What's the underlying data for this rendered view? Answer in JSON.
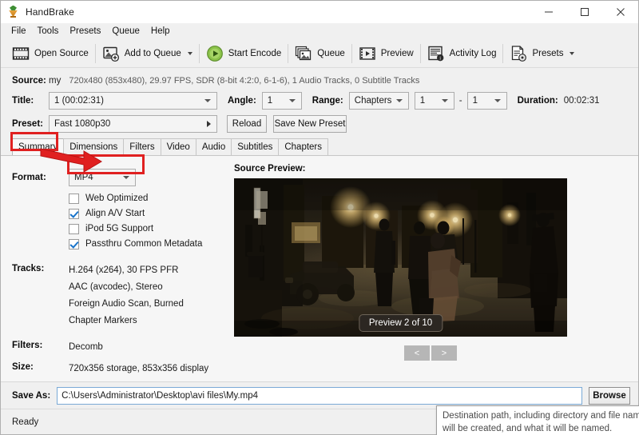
{
  "window": {
    "title": "HandBrake",
    "logo_icon": "handbrake-logo",
    "minimize_label": "—",
    "maximize_label": "□",
    "close_label": "✕"
  },
  "menubar": {
    "items": [
      {
        "label": "File"
      },
      {
        "label": "Tools"
      },
      {
        "label": "Presets"
      },
      {
        "label": "Queue"
      },
      {
        "label": "Help"
      }
    ]
  },
  "toolbar": {
    "items": [
      {
        "label": "Open Source",
        "icon": "film-strip-icon",
        "has_caret": false
      },
      {
        "label": "Add to Queue",
        "icon": "add-image-icon",
        "has_caret": true
      },
      {
        "label": "Start Encode",
        "icon": "green-play-icon",
        "has_caret": false
      },
      {
        "label": "Queue",
        "icon": "stacked-images-icon",
        "has_caret": false
      },
      {
        "label": "Preview",
        "icon": "film-play-icon",
        "has_caret": false
      },
      {
        "label": "Activity Log",
        "icon": "log-info-icon",
        "has_caret": false
      },
      {
        "label": "Presets",
        "icon": "document-gear-icon",
        "has_caret": true
      }
    ]
  },
  "source": {
    "label": "Source:",
    "name": "my",
    "details": "720x480 (853x480), 29.97 FPS, SDR (8-bit 4:2:0, 6-1-6), 1 Audio Tracks, 0 Subtitle Tracks"
  },
  "title_row": {
    "title_label": "Title:",
    "title_value": "1  (00:02:31)",
    "angle_label": "Angle:",
    "angle_value": "1",
    "range_label": "Range:",
    "range_value": "Chapters",
    "chapter_start": "1",
    "chapter_sep": "-",
    "chapter_end": "1",
    "duration_label": "Duration:",
    "duration_value": "00:02:31"
  },
  "preset_row": {
    "preset_label": "Preset:",
    "preset_value": "Fast 1080p30",
    "reload_label": "Reload",
    "save_new_preset_label": "Save New Preset"
  },
  "tabs": [
    {
      "label": "Summary",
      "active": true
    },
    {
      "label": "Dimensions",
      "active": false
    },
    {
      "label": "Filters",
      "active": false
    },
    {
      "label": "Video",
      "active": false
    },
    {
      "label": "Audio",
      "active": false
    },
    {
      "label": "Subtitles",
      "active": false
    },
    {
      "label": "Chapters",
      "active": false
    }
  ],
  "summary": {
    "format_label": "Format:",
    "format_value": "MP4",
    "checkboxes": [
      {
        "label": "Web Optimized",
        "checked": false
      },
      {
        "label": "Align A/V Start",
        "checked": true
      },
      {
        "label": "iPod 5G Support",
        "checked": false
      },
      {
        "label": "Passthru Common Metadata",
        "checked": true
      }
    ],
    "tracks_label": "Tracks:",
    "tracks": [
      "H.264 (x264), 30 FPS PFR",
      "AAC (avcodec), Stereo",
      "Foreign Audio Scan, Burned",
      "Chapter Markers"
    ],
    "filters_label": "Filters:",
    "filters_value": "Decomb",
    "size_label": "Size:",
    "size_value": "720x356 storage, 853x356 display"
  },
  "preview": {
    "label": "Source Preview:",
    "badge": "Preview 2 of 10",
    "prev_label": "<",
    "next_label": ">"
  },
  "save_as": {
    "label": "Save As:",
    "value": "C:\\Users\\Administrator\\Desktop\\avi files\\My.mp4",
    "browse_label": "Browse"
  },
  "status": {
    "text": "Ready"
  },
  "tooltip": {
    "line1": "Destination path, including directory and file name. Th",
    "line2": "will be created, and what it will be named."
  },
  "annotations": {
    "highlight_color": "#e02020",
    "boxes": [
      {
        "target": "summary-tab"
      },
      {
        "target": "format-combo"
      }
    ],
    "arrow": {
      "from": "summary-tab",
      "to": "format-combo"
    }
  }
}
